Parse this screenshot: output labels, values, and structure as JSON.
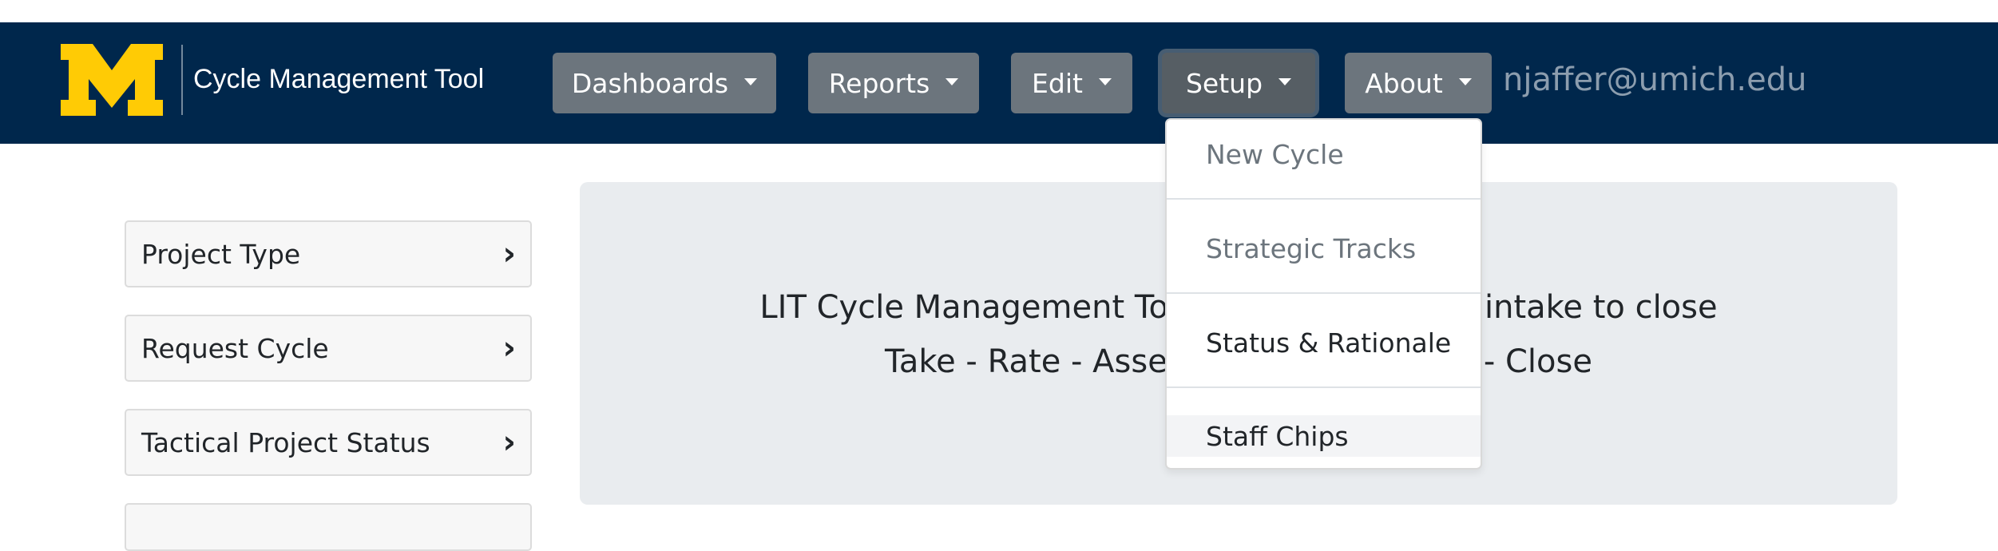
{
  "header": {
    "brand_title": "Cycle Management Tool",
    "user_email": "njaffer@umich.edu",
    "colors": {
      "navbar": "#00274c",
      "logo": "#ffcb05",
      "button": "#6c757d"
    }
  },
  "nav": {
    "items": [
      {
        "label": "Dashboards"
      },
      {
        "label": "Reports"
      },
      {
        "label": "Edit"
      },
      {
        "label": "Setup",
        "active": true
      },
      {
        "label": "About"
      }
    ]
  },
  "setup_menu": {
    "items": [
      {
        "label": "New Cycle"
      },
      {
        "label": "Strategic Tracks"
      },
      {
        "label": "Status & Rationale"
      },
      {
        "label": "Staff Chips"
      }
    ]
  },
  "sidebar": {
    "items": [
      {
        "label": "Project Type",
        "chevron": "›"
      },
      {
        "label": "Request Cycle",
        "chevron": "›"
      },
      {
        "label": "Tactical Project Status",
        "chevron": "›"
      }
    ]
  },
  "jumbotron": {
    "line1_left": "LIT Cycle Management To",
    "line1_right": "intake to close",
    "line2_left": "Take - Rate - Asse",
    "line2_right": "- Close"
  }
}
